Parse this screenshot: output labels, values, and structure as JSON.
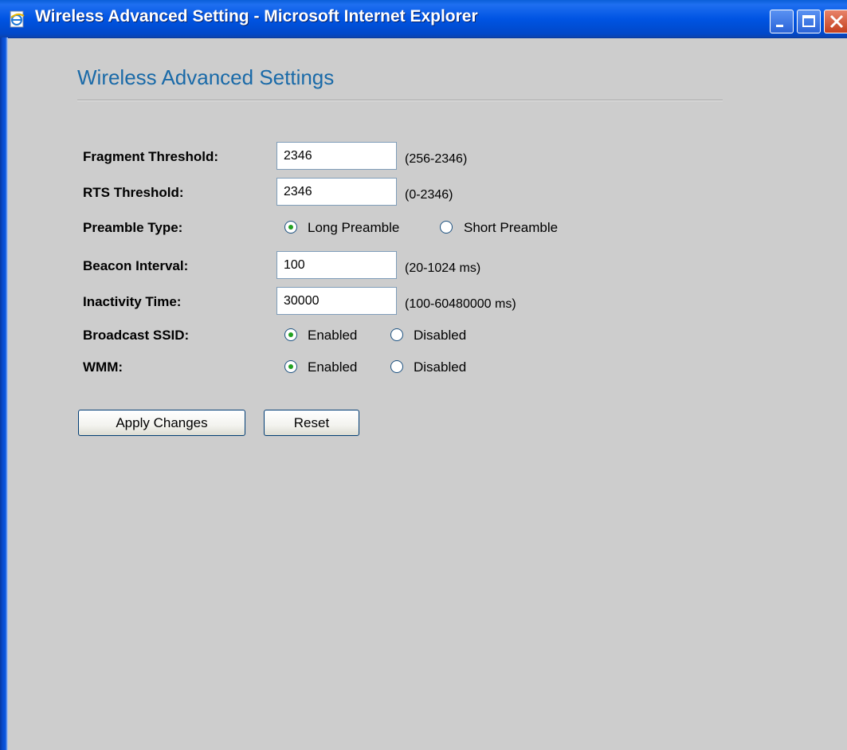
{
  "window": {
    "title": "Wireless Advanced Setting - Microsoft Internet Explorer"
  },
  "page": {
    "heading": "Wireless Advanced Settings"
  },
  "form": {
    "fragment_threshold": {
      "label": "Fragment Threshold:",
      "value": "2346",
      "hint": "(256-2346)"
    },
    "rts_threshold": {
      "label": "RTS Threshold:",
      "value": "2346",
      "hint": "(0-2346)"
    },
    "preamble_type": {
      "label": "Preamble Type:",
      "option_long": "Long Preamble",
      "option_short": "Short Preamble",
      "selected": "Long Preamble"
    },
    "beacon_interval": {
      "label": "Beacon Interval:",
      "value": "100",
      "hint": "(20-1024 ms)"
    },
    "inactivity_time": {
      "label": "Inactivity Time:",
      "value": "30000",
      "hint": "(100-60480000 ms)"
    },
    "broadcast_ssid": {
      "label": "Broadcast SSID:",
      "option_enabled": "Enabled",
      "option_disabled": "Disabled",
      "selected": "Enabled"
    },
    "wmm": {
      "label": "WMM:",
      "option_enabled": "Enabled",
      "option_disabled": "Disabled",
      "selected": "Enabled"
    }
  },
  "buttons": {
    "apply": "Apply Changes",
    "reset": "Reset"
  },
  "colors": {
    "titlebar": "#0054e3",
    "heading": "#1a6aa8",
    "content_bg": "#cdcdcd",
    "radio_dot": "#21a121"
  },
  "icons": {
    "app": "ie-page-icon",
    "minimize": "minimize-icon",
    "maximize": "maximize-icon",
    "close": "close-icon",
    "radio_checked": "radio-checked-icon",
    "radio_unchecked": "radio-unchecked-icon"
  }
}
